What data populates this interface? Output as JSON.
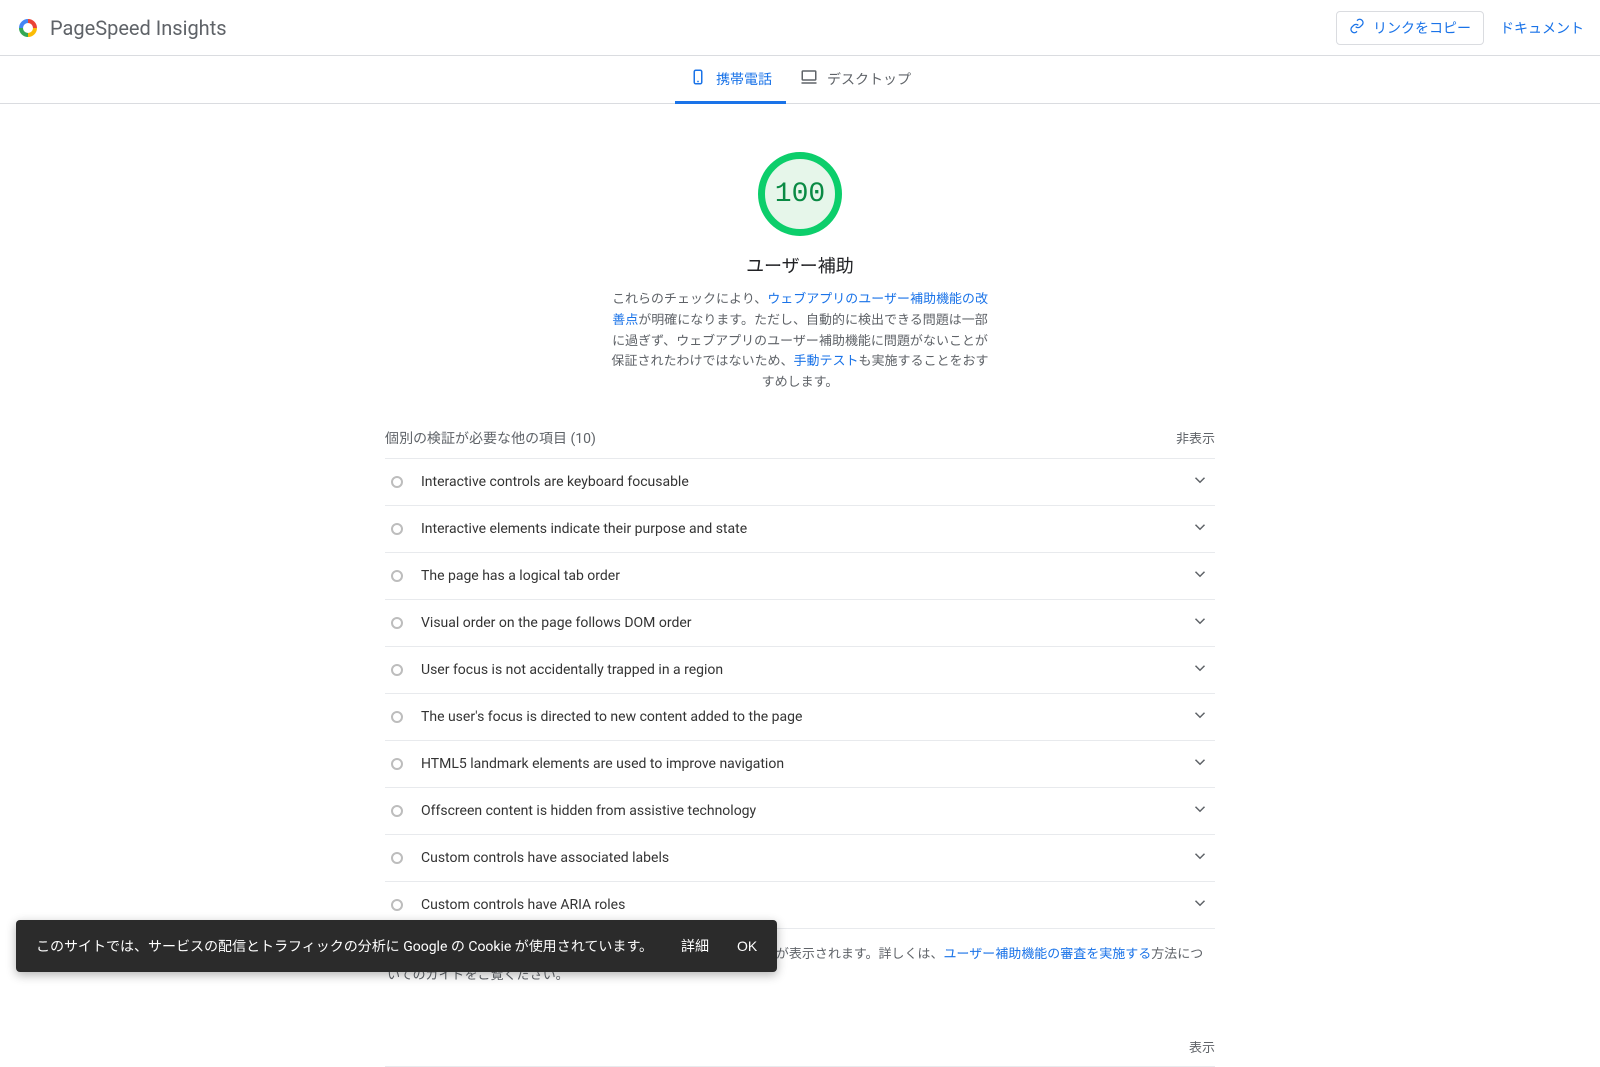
{
  "header": {
    "appTitle": "PageSpeed Insights",
    "copyLabel": "リンクをコピー",
    "docLabel": "ドキュメント"
  },
  "tabs": {
    "mobile": "携帯電話",
    "desktop": "デスクトップ"
  },
  "gauge": {
    "score": "100",
    "title": "ユーザー補助",
    "desc_pre": "これらのチェックにより、",
    "desc_link1": "ウェブアプリのユーザー補助機能の改善点",
    "desc_mid": "が明確になります。ただし、自動的に検出できる問題は一部に過ぎず、ウェブアプリのユーザー補助機能に問題がないことが保証されたわけではないため、",
    "desc_link2": "手動テスト",
    "desc_post": "も実施することをおすすめします。"
  },
  "manualSection": {
    "title": "個別の検証が必要な他の項目 (10)",
    "toggle": "非表示"
  },
  "audits": [
    {
      "title": "Interactive controls are keyboard focusable"
    },
    {
      "title": "Interactive elements indicate their purpose and state"
    },
    {
      "title": "The page has a logical tab order"
    },
    {
      "title": "Visual order on the page follows DOM order"
    },
    {
      "title": "User focus is not accidentally trapped in a region"
    },
    {
      "title": "The user's focus is directed to new content added to the page"
    },
    {
      "title": "HTML5 landmark elements are used to improve navigation"
    },
    {
      "title": "Offscreen content is hidden from assistive technology"
    },
    {
      "title": "Custom controls have associated labels"
    },
    {
      "title": "Custom controls have ARIA roles"
    }
  ],
  "footerNote": {
    "pre": "ここに、自動テストツールではカバーできない範囲に対処する項目が表示されます。詳しくは、",
    "link": "ユーザー補助機能の審査を実施する",
    "post": "方法についてのガイドをご覧ください。"
  },
  "passedSection": {
    "toggle": "表示"
  },
  "cookie": {
    "msg": "このサイトでは、サービスの配信とトラフィックの分析に Google の Cookie が使用されています。",
    "details": "詳細",
    "ok": "OK"
  }
}
